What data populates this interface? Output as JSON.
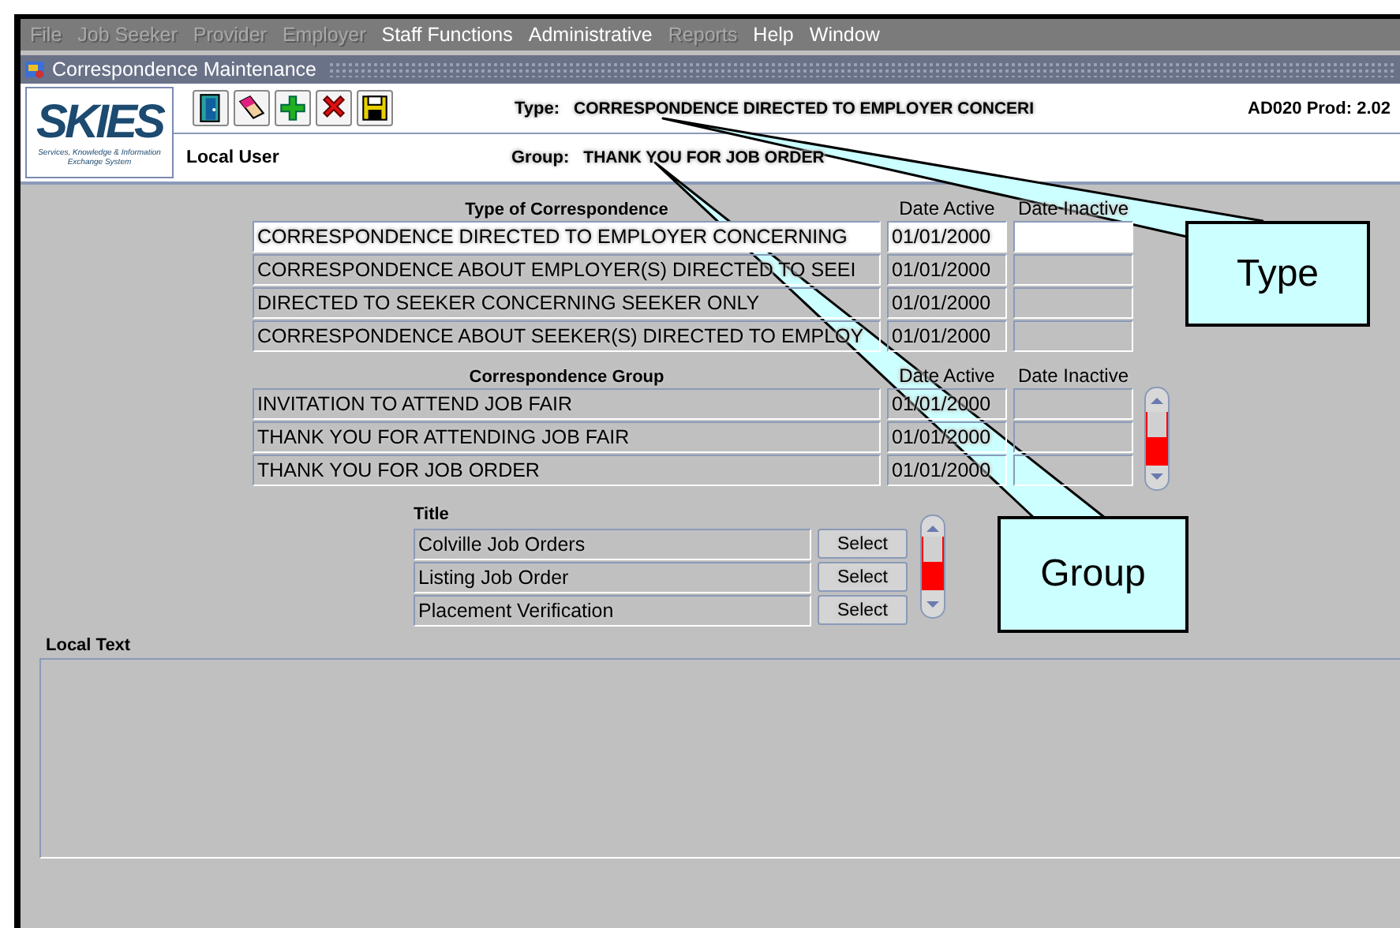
{
  "menu": [
    {
      "label": "File",
      "disabled": true
    },
    {
      "label": "Job Seeker",
      "disabled": true
    },
    {
      "label": "Provider",
      "disabled": true
    },
    {
      "label": "Employer",
      "disabled": true
    },
    {
      "label": "Staff Functions",
      "disabled": false
    },
    {
      "label": "Administrative",
      "disabled": false
    },
    {
      "label": "Reports",
      "disabled": true
    },
    {
      "label": "Help",
      "disabled": false
    },
    {
      "label": "Window",
      "disabled": false
    }
  ],
  "window": {
    "title": "Correspondence Maintenance"
  },
  "logo": {
    "name": "SKIES",
    "tagline": "Services, Knowledge & Information Exchange System"
  },
  "header": {
    "type_label": "Type:",
    "type_value": "CORRESPONDENCE DIRECTED TO EMPLOYER CONCERI",
    "version": "AD020 Prod: 2.02",
    "user": "Local User",
    "group_label": "Group:",
    "group_value": "THANK YOU FOR JOB ORDER"
  },
  "type_table": {
    "columns": [
      "Type of Correspondence",
      "Date Active",
      "Date Inactive"
    ],
    "rows": [
      {
        "name": "CORRESPONDENCE DIRECTED TO EMPLOYER CONCERNING",
        "date_active": "01/01/2000",
        "selected": true
      },
      {
        "name": "CORRESPONDENCE ABOUT EMPLOYER(S) DIRECTED TO SEEI",
        "date_active": "01/01/2000",
        "selected": false
      },
      {
        "name": "DIRECTED TO SEEKER CONCERNING SEEKER ONLY",
        "date_active": "01/01/2000",
        "selected": false
      },
      {
        "name": "CORRESPONDENCE ABOUT SEEKER(S) DIRECTED TO EMPLOY",
        "date_active": "01/01/2000",
        "selected": false
      }
    ]
  },
  "group_table": {
    "columns": [
      "Correspondence Group",
      "Date Active",
      "Date Inactive"
    ],
    "rows": [
      {
        "name": "INVITATION TO ATTEND JOB FAIR",
        "date_active": "01/01/2000"
      },
      {
        "name": "THANK YOU FOR ATTENDING JOB FAIR",
        "date_active": "01/01/2000"
      },
      {
        "name": "THANK YOU FOR JOB ORDER",
        "date_active": "01/01/2000"
      }
    ]
  },
  "title_table": {
    "column": "Title",
    "rows": [
      {
        "title": "Colville Job Orders",
        "button": "Select"
      },
      {
        "title": "Listing Job Order",
        "button": "Select"
      },
      {
        "title": "Placement Verification",
        "button": "Select"
      }
    ]
  },
  "local_text": {
    "label": "Local Text"
  },
  "callouts": [
    {
      "label": "Type"
    },
    {
      "label": "Group"
    }
  ]
}
